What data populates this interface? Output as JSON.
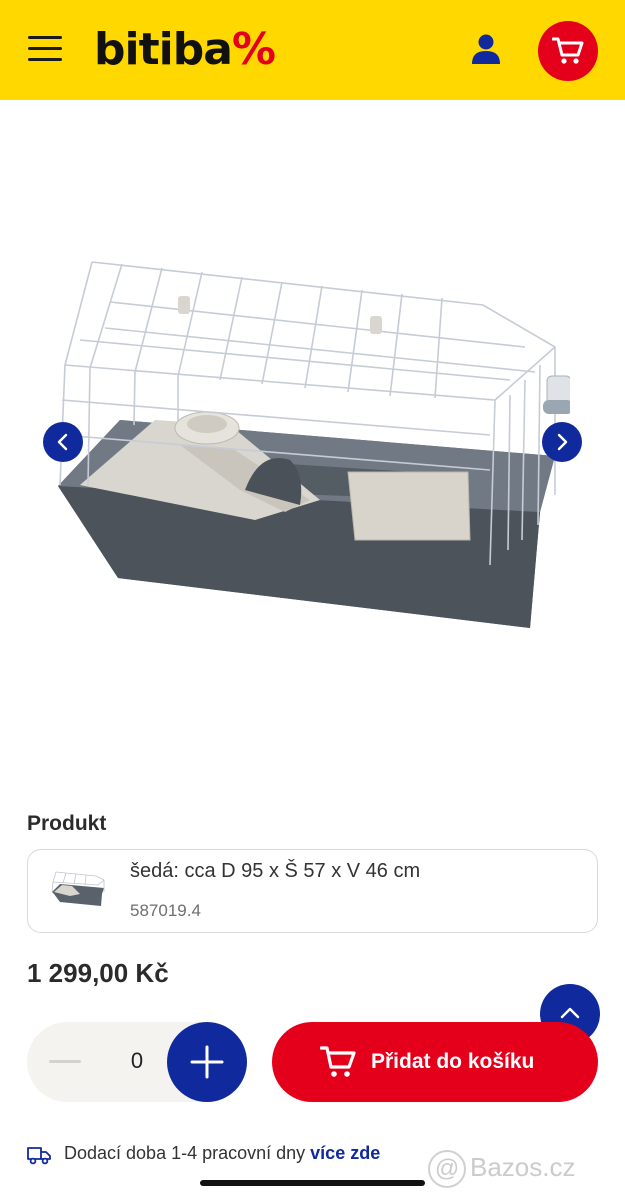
{
  "header": {
    "logo_text": "bitiba",
    "logo_symbol": "%",
    "brand_color": "#ffd800",
    "accent_color": "#e4001b",
    "icons": [
      "hamburger-menu-icon",
      "user-icon",
      "cart-icon"
    ]
  },
  "gallery": {
    "image": "rabbit-cage-photo",
    "prev_icon": "chevron-left-icon",
    "next_icon": "chevron-right-icon"
  },
  "product": {
    "section_title": "Produkt",
    "variant_name": "šedá: cca D 95 x Š 57 x V 46 cm",
    "variant_code": "587019.4",
    "price": "1 299,00 Kč"
  },
  "purchase": {
    "quantity": "0",
    "add_label": "Přidat do košíku",
    "primary_color": "#102a9e"
  },
  "delivery": {
    "text": "Dodací doba 1-4 pracovní dny",
    "link": "více zde"
  },
  "watermark": {
    "at": "@",
    "text": "Bazos.cz"
  }
}
